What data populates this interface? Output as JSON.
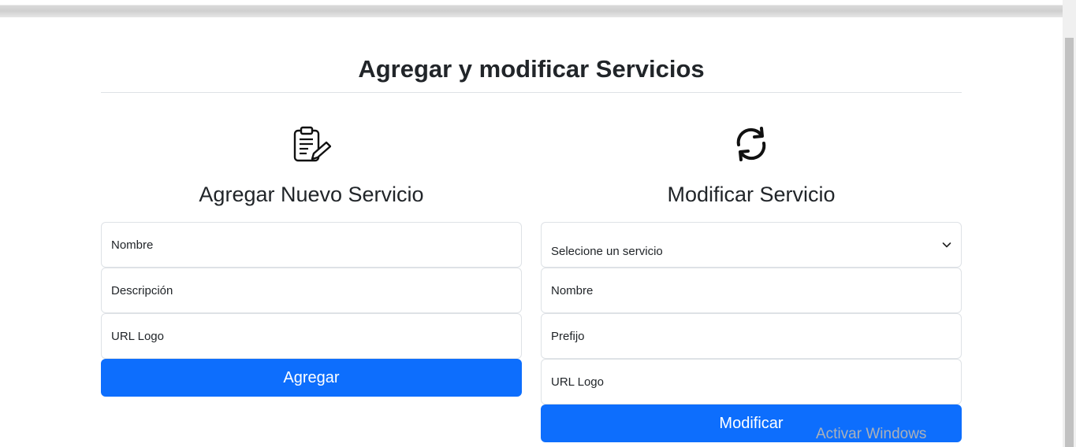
{
  "page": {
    "title": "Agregar y modificar Servicios"
  },
  "add_section": {
    "icon": "clipboard-edit-icon",
    "title": "Agregar Nuevo Servicio",
    "fields": [
      {
        "placeholder": "Nombre"
      },
      {
        "placeholder": "Descripción"
      },
      {
        "placeholder": "URL Logo"
      }
    ],
    "button_label": "Agregar"
  },
  "modify_section": {
    "icon": "refresh-icon",
    "title": "Modificar Servicio",
    "select_value": "Selecione un servicio",
    "fields": [
      {
        "placeholder": "Nombre"
      },
      {
        "placeholder": "Prefijo"
      },
      {
        "placeholder": "URL Logo"
      }
    ],
    "button_label": "Modificar"
  },
  "watermark": "Activar Windows",
  "colors": {
    "primary": "#0d6efd",
    "border": "#dee2e6",
    "text": "#212529"
  }
}
